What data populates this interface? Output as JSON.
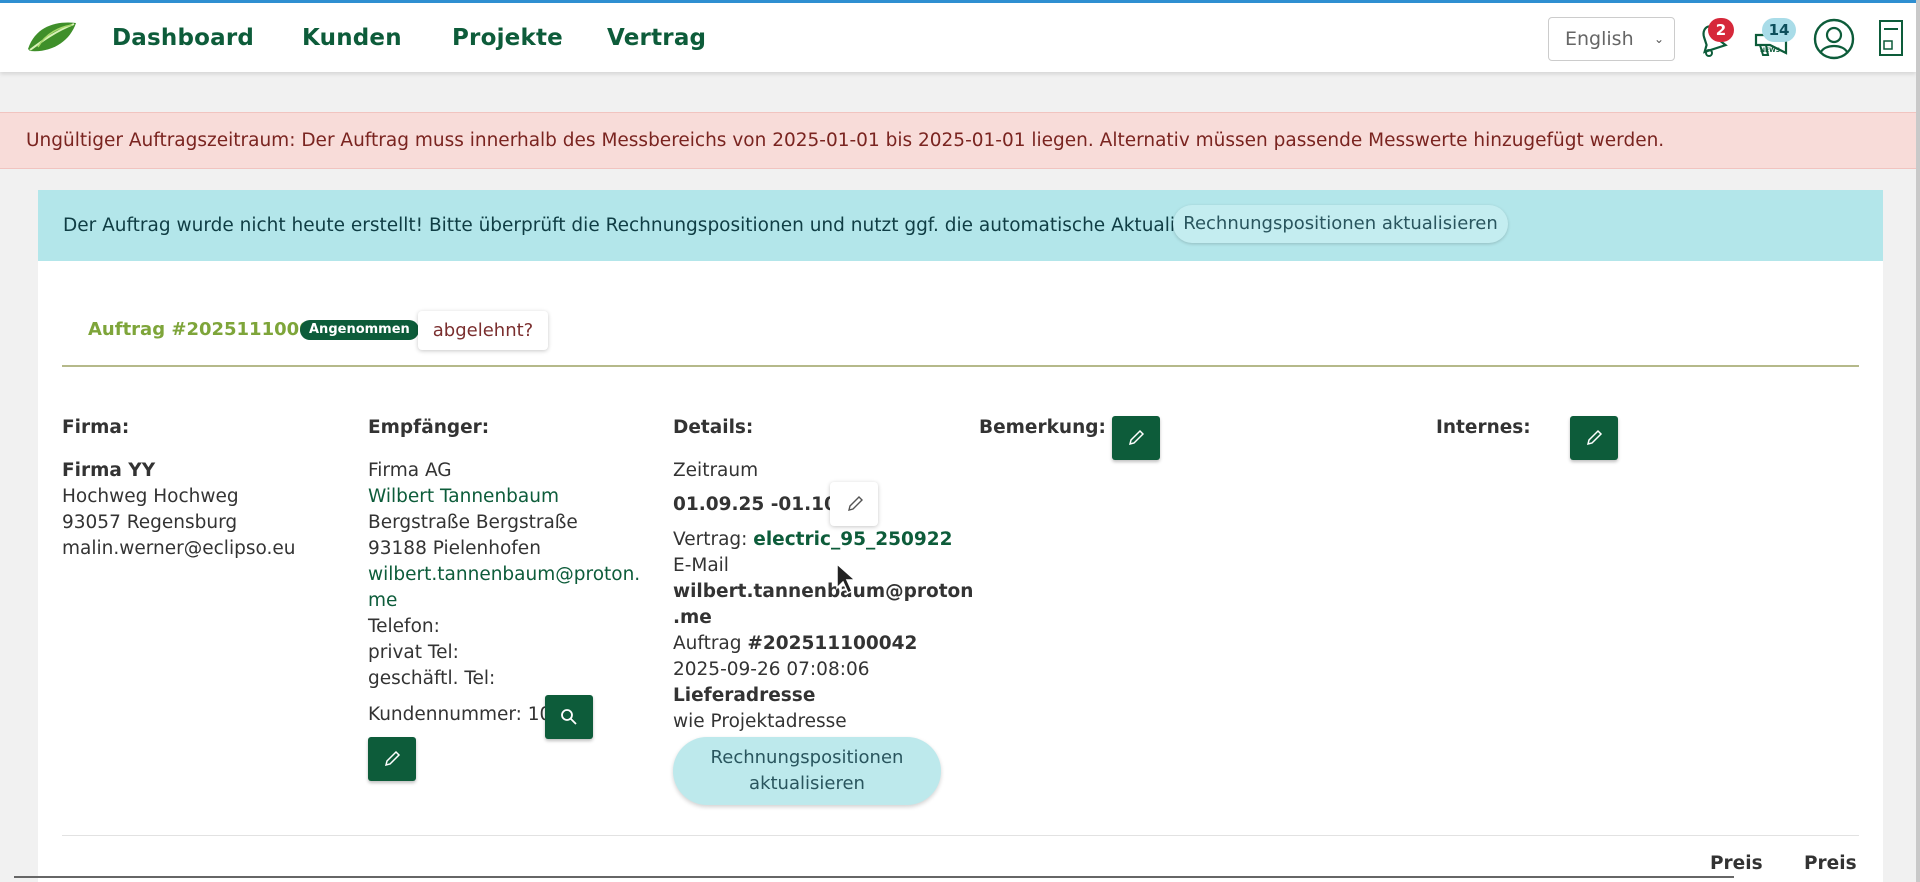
{
  "nav": {
    "items": [
      "Dashboard",
      "Kunden",
      "Projekte",
      "Vertrag"
    ],
    "language": "English",
    "notifications_count": "2",
    "news_count": "14"
  },
  "alert_error": "Ungültiger Auftragszeitraum: Der Auftrag muss innerhalb des Messbereichs von 2025-01-01 bis 2025-01-01 liegen. Alternativ müssen passende Messwerte hinzugefügt werden.",
  "alert_info": {
    "message": "Der Auftrag wurde nicht heute erstellt! Bitte überprüft die Rechnungspositionen und nutzt ggf. die automatische Aktualisierung.",
    "button": "Rechnungspositionen aktualisieren"
  },
  "order": {
    "title": "Auftrag #202511100042",
    "status": "Angenommen",
    "reject_label": "abgelehnt?"
  },
  "firma": {
    "heading": "Firma:",
    "name": "Firma YY",
    "street": "Hochweg Hochweg",
    "city": "93057 Regensburg",
    "email": "malin.werner@eclipso.eu"
  },
  "empfaenger": {
    "heading": "Empfänger:",
    "company": "Firma AG",
    "contact": "Wilbert Tannenbaum",
    "street": "Bergstraße Bergstraße",
    "city": "93188 Pielenhofen",
    "email_line1": "wilbert.tannenbaum@proton.",
    "email_line2": "me",
    "telefon": "Telefon:",
    "privat": "privat Tel:",
    "geschaeftl": "geschäftl. Tel:",
    "kundennummer": "Kundennummer: 101"
  },
  "details": {
    "heading": "Details:",
    "zeitraum_label": "Zeitraum",
    "zeitraum": "01.09.25 -01.10.25",
    "vertrag_label": "Vertrag:",
    "vertrag": "electric_95_250922",
    "email_label": "E-Mail",
    "email_line1": "wilbert.tannenbaum@proton",
    "email_line2": ".me",
    "auftrag_label": "Auftrag",
    "auftrag": "#202511100042",
    "date": "2025-09-26 07:08:06",
    "lieferadresse_label": "Lieferadresse",
    "lieferadresse": "wie Projektadresse",
    "button_line1": "Rechnungspositionen",
    "button_line2": "aktualisieren"
  },
  "bemerkung": {
    "heading": "Bemerkung:"
  },
  "internes": {
    "heading": "Internes:"
  },
  "table": {
    "headers": [
      "Preis",
      "Preis"
    ]
  },
  "colors": {
    "brand_green": "#0d5c3a",
    "olive": "#7ea53a",
    "error_bg": "#f8dcd9",
    "info_bg": "#b3e6ea"
  }
}
